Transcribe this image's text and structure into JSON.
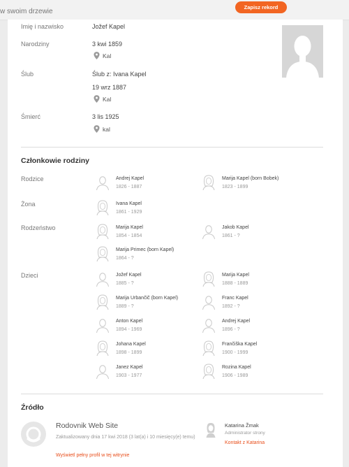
{
  "header": {
    "title": "w swoim drzewie",
    "save_label": "Zapisz rekord"
  },
  "facts": {
    "name": {
      "label": "Imię i nazwisko",
      "value": "Jožef Kapel"
    },
    "birth": {
      "label": "Narodziny",
      "date": "3 kwi 1859",
      "place": "Kal"
    },
    "marriage": {
      "label": "Ślub",
      "spouse": "Ślub z: Ivana Kapel",
      "date": "19 wrz 1887",
      "place": "Kal"
    },
    "death": {
      "label": "Śmierć",
      "date": "3 lis 1925",
      "place": "kal"
    }
  },
  "family": {
    "title": "Członkowie rodziny",
    "parents_label": "Rodzice",
    "spouse_label": "Żona",
    "siblings_label": "Rodzeństwo",
    "children_label": "Dzieci",
    "parents": [
      {
        "name": "Andrej Kapel",
        "dates": "1826 - 1887",
        "gender": "m"
      },
      {
        "name": "Marija Kapel (born Bobek)",
        "dates": "1823 - 1899",
        "gender": "f"
      }
    ],
    "spouse": [
      {
        "name": "Ivana Kapel",
        "dates": "1861 - 1929",
        "gender": "f"
      }
    ],
    "siblings": [
      {
        "name": "Marija Kapel",
        "dates": "1854 - 1854",
        "gender": "f"
      },
      {
        "name": "Jakob Kapel",
        "dates": "1861 - ?",
        "gender": "m"
      },
      {
        "name": "Marija Primec (born Kapel)",
        "dates": "1864 - ?",
        "gender": "f"
      }
    ],
    "children": [
      {
        "name": "Jožef Kapel",
        "dates": "1885 - ?",
        "gender": "m"
      },
      {
        "name": "Marija Kapel",
        "dates": "1888 - 1889",
        "gender": "f"
      },
      {
        "name": "Marija Urbančič (born Kapel)",
        "dates": "1889 - ?",
        "gender": "f"
      },
      {
        "name": "Franc Kapel",
        "dates": "1892 - ?",
        "gender": "m"
      },
      {
        "name": "Anton Kapel",
        "dates": "1894 - 1969",
        "gender": "m"
      },
      {
        "name": "Andrej Kapel",
        "dates": "1896 - ?",
        "gender": "m"
      },
      {
        "name": "Johana Kapel",
        "dates": "1898 - 1899",
        "gender": "f"
      },
      {
        "name": "Frančiška Kapel",
        "dates": "1900 - 1999",
        "gender": "f"
      },
      {
        "name": "Janez Kapel",
        "dates": "1903 - 1977",
        "gender": "m"
      },
      {
        "name": "Rozina Kapel",
        "dates": "1906 - 1989",
        "gender": "f"
      }
    ]
  },
  "source": {
    "title": "Źródło",
    "site_name": "Rodovnik Web Site",
    "updated": "Zaktualizowany dnia 17 kwi 2018 (3 lat(a) i 10 miesięcy(e) temu)",
    "view_link": "Wyświetl pełny profil w tej witrynie",
    "manager_name": "Katarina Žmak",
    "manager_role": "Administrator strony",
    "contact_link": "Kontakt z Katarina"
  },
  "colors": {
    "accent": "#f26522",
    "link": "#e84e1b"
  },
  "icons": {
    "place": "map-pin-icon",
    "male": "male-avatar-icon",
    "female": "female-avatar-icon"
  }
}
